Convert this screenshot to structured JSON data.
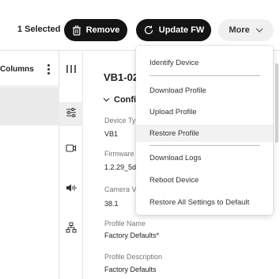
{
  "toolbar": {
    "selected_count": "1 Selected",
    "remove_label": "Remove",
    "update_fw_label": "Update FW",
    "more_label": "More"
  },
  "table": {
    "columns_label": "Columns"
  },
  "detail": {
    "device_title": "VB1-02",
    "section_title": "Configu",
    "fields": {
      "device_type_label": "Device Ty",
      "device_type_value": "VB1",
      "firmware_label": "Firmware",
      "firmware_value": "1.2.29_5d",
      "camera_label": "Camera V",
      "camera_value": "38.1",
      "profile_name_label": "Profile Name",
      "profile_name_value": "Factory Defaults*",
      "profile_desc_label": "Profile Description",
      "profile_desc_value": "Factory Defaults"
    }
  },
  "menu": {
    "items": [
      "Identify Device",
      "Download Profile",
      "Upload Profile",
      "Restore Profile",
      "Download Logs",
      "Reboot Device",
      "Restore All Settings to Default"
    ]
  },
  "icons": {
    "trash": "trash-icon",
    "update": "refresh-icon",
    "chevron": "chevron-down-icon",
    "kebab": "kebab-menu-icon",
    "columns": "columns-icon",
    "settings": "sliders-icon",
    "camera": "video-camera-icon",
    "audio": "audio-icon",
    "network": "network-icon"
  },
  "colors": {
    "primary_button": "#141414",
    "secondary_button": "#f0f0f0",
    "hover_row": "#f2f2f2",
    "selected_row": "#eaeaea"
  }
}
